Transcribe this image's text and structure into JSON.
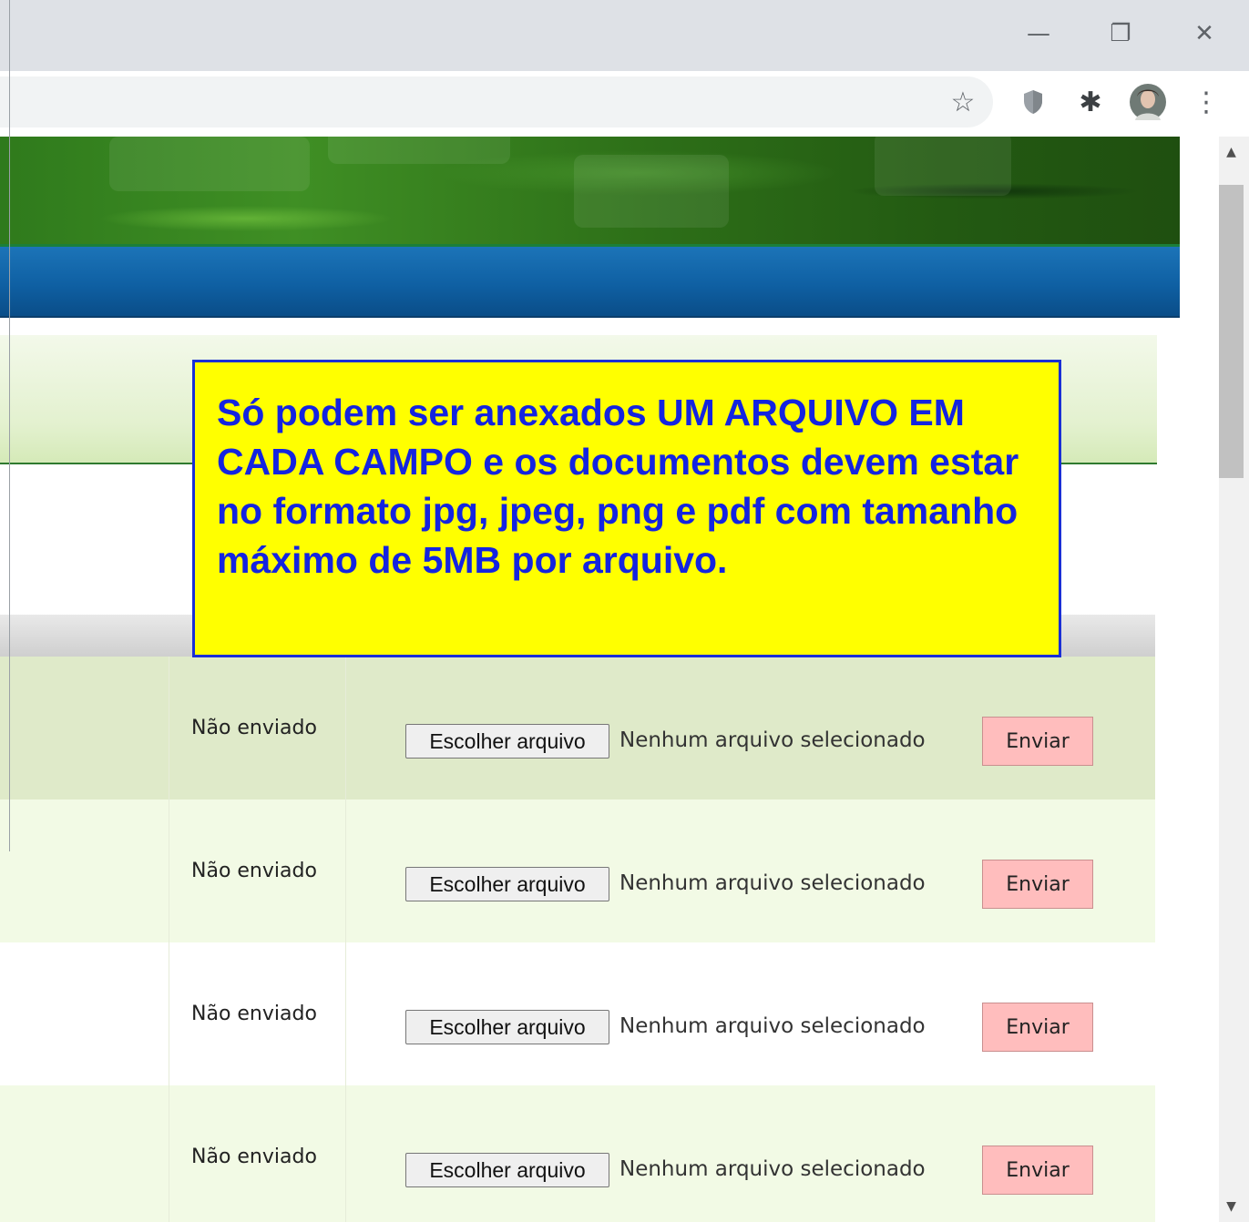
{
  "window": {
    "minimize_glyph": "—",
    "restore_glyph": "❐",
    "close_glyph": "✕"
  },
  "toolbar": {
    "icons": [
      "star-icon",
      "shield-icon",
      "puzzle-icon",
      "avatar",
      "kebab-menu-icon"
    ],
    "star_glyph": "☆",
    "puzzle_glyph": "✱",
    "kebab_glyph": "⋮"
  },
  "colors": {
    "callout_bg": "#ffff00",
    "callout_text": "#1424e0",
    "send_button_bg": "#ffbdbd",
    "navbar": "#0f60a3",
    "banner": "#2f7a1c"
  },
  "notice": {
    "text": "Só podem ser anexados UM ARQUIVO EM CADA CAMPO e os documentos devem estar no formato  jpg, jpeg, png e pdf com tamanho máximo de 5MB por arquivo."
  },
  "uploads": {
    "rows": [
      {
        "status": "Não enviado",
        "choose_label": "Escolher arquivo",
        "file_state": "Nenhum arquivo selecionado",
        "send_label": "Enviar"
      },
      {
        "status": "Não enviado",
        "choose_label": "Escolher arquivo",
        "file_state": "Nenhum arquivo selecionado",
        "send_label": "Enviar"
      },
      {
        "status": "Não enviado",
        "choose_label": "Escolher arquivo",
        "file_state": "Nenhum arquivo selecionado",
        "send_label": "Enviar"
      },
      {
        "status": "Não enviado",
        "choose_label": "Escolher arquivo",
        "file_state": "Nenhum arquivo selecionado",
        "send_label": "Enviar"
      }
    ]
  },
  "scrollbar": {
    "up_glyph": "▲",
    "down_glyph": "▼"
  }
}
